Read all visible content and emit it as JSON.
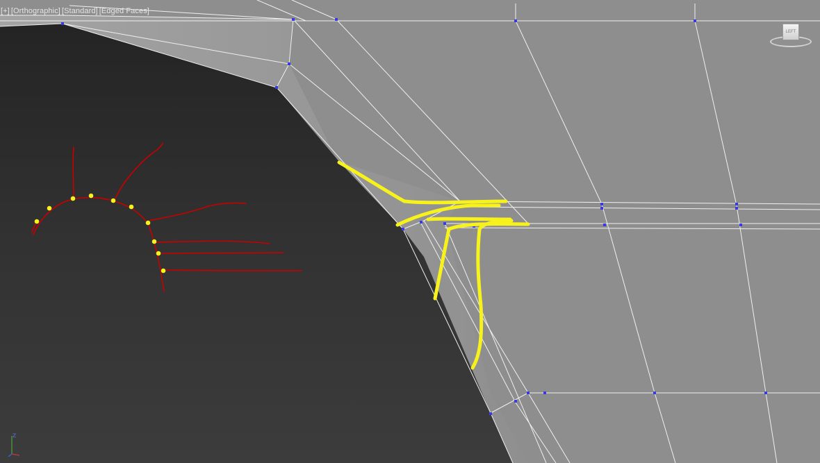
{
  "viewport": {
    "label_parts": [
      "[+]",
      "[Orthographic]",
      "[Standard]",
      "[Edged Faces]"
    ]
  },
  "viewcube": {
    "face_label": "LEFT",
    "icon": "viewcube-icon"
  },
  "axis_gizmo": {
    "z_label": "z",
    "icon": "axis-tripod-icon"
  },
  "scene": {
    "background_color": "#8e8e8e",
    "dark_face_color": "#2e2e2e",
    "wire_color": "#f0f0f0",
    "vertex_color": "#3b3bdc",
    "annotation_red": "#c80000",
    "annotation_yellow": "#f7f21c"
  }
}
